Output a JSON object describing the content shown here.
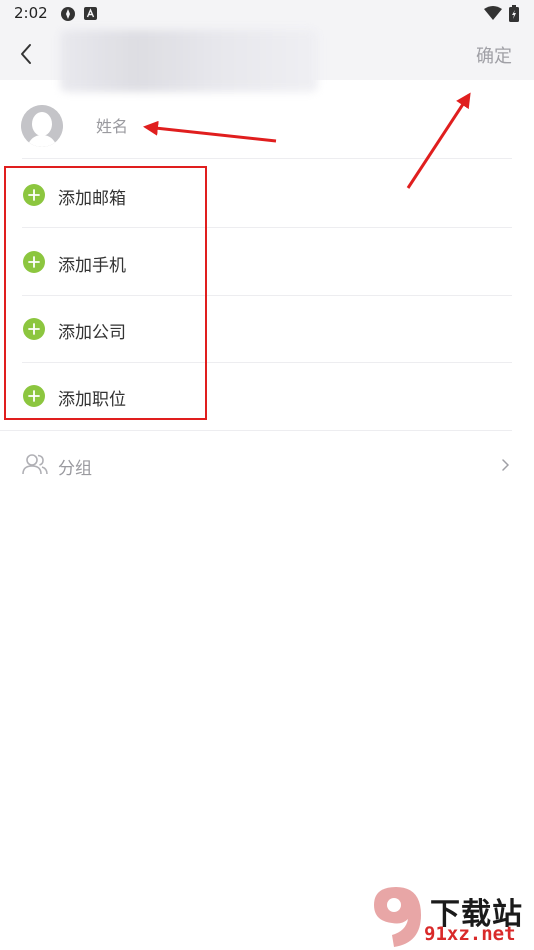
{
  "status_bar": {
    "time": "2:02"
  },
  "header": {
    "confirm_label": "确定"
  },
  "name_field": {
    "placeholder": "姓名"
  },
  "add_items": [
    {
      "label": "添加邮箱"
    },
    {
      "label": "添加手机"
    },
    {
      "label": "添加公司"
    },
    {
      "label": "添加职位"
    }
  ],
  "group": {
    "label": "分组"
  },
  "watermark": {
    "text": "下载站",
    "url": "91xz.net"
  },
  "colors": {
    "accent_green": "#8cc63f",
    "annotation_red": "#e01e1e",
    "header_bg": "#f4f4f6"
  }
}
